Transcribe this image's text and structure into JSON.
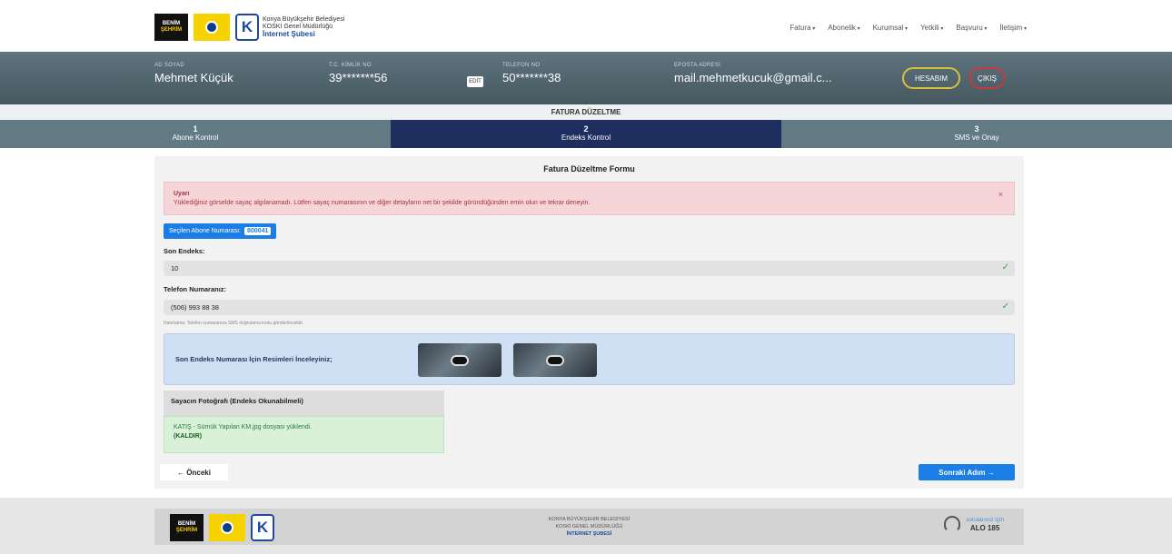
{
  "header": {
    "logo_benim_line1": "BENİM",
    "logo_benim_line2": "ŞEHRİM",
    "logo_k": "K",
    "org_line1": "Konya Büyükşehir Belediyesi",
    "org_line2": "KOSKİ Genel Müdürlüğü",
    "org_line3": "İnternet Şubesi",
    "nav": [
      {
        "label": "Fatura"
      },
      {
        "label": "Abonelik"
      },
      {
        "label": "Kurumsal"
      },
      {
        "label": "Yetkili"
      },
      {
        "label": "Başvuru"
      },
      {
        "label": "İletişim"
      }
    ]
  },
  "user": {
    "name_label": "AD SOYAD",
    "name": "Mehmet Küçük",
    "tc_label": "T.C. KİMLİK NO",
    "tc": "39*******56",
    "edit": "EDİT",
    "phone_label": "TELEFON NO",
    "phone": "50*******38",
    "email_label": "EPOSTA ADRESİ",
    "email": "mail.mehmetkucuk@gmail.c...",
    "account_button": "HESABIM",
    "logout_button": "ÇIKIŞ"
  },
  "page_title": "FATURA DÜZELTME",
  "steps": [
    {
      "num": "1",
      "label": "Abone Kontrol"
    },
    {
      "num": "2",
      "label": "Endeks Kontrol"
    },
    {
      "num": "3",
      "label": "SMS ve Onay"
    }
  ],
  "form": {
    "title": "Fatura Düzeltme Formu",
    "alert_title": "Uyarı",
    "alert_text": "Yüklediğiniz görselde sayaç algılanamadı. Lütfen sayaç numarasının ve diğer detayların net bir şekilde göründüğünden emin olun ve tekrar deneyin.",
    "alert_close": "×",
    "selected_subscriber_label": "Seçilen Abone Numarası:",
    "selected_subscriber_no": "800041",
    "last_index_label": "Son Endeks:",
    "last_index_value": "10",
    "phone_label": "Telefon Numaranız:",
    "phone_value": "(506) 993 88 38",
    "phone_hint": "Hatırlatma: Telefon numaranıza SMS doğrulama kodu gönderilecektir.",
    "images_label": "Son Endeks Numarası İçin Resimleri İnceleyiniz;",
    "photo_head": "Sayacın Fotoğrafı (Endeks Okunabilmeli)",
    "photo_file": "KATIŞ - Sümük Yapılan KM.jpg dosyası yüklendi.",
    "photo_remove": "(KALDIR)",
    "prev_button": "← Önceki",
    "next_button": "Sonraki Adım →"
  },
  "footer": {
    "line1": "KONYA BÜYÜKŞEHİR BELEDİYESİ",
    "line2": "KOSKİ GENEL MÜDÜRLÜĞÜ",
    "line3": "İNTERNET ŞUBESİ",
    "alo_text": "sorularınız için",
    "alo_number": "ALO 185"
  }
}
